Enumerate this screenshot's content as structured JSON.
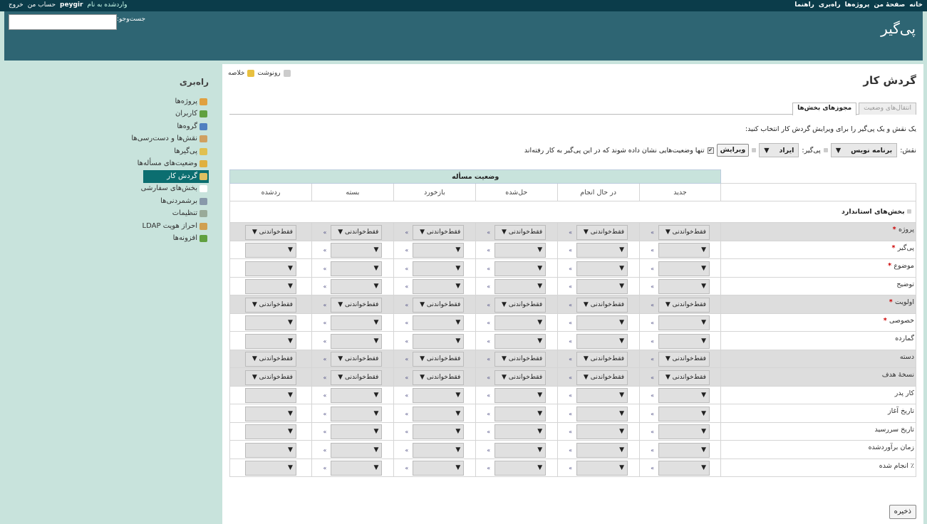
{
  "topbar": {
    "menu": [
      "خانه",
      "صفحهٔ من",
      "پروژه‌ها",
      "راه‌بری",
      "راهنما"
    ],
    "logged_in_label": "واردشده به نام",
    "username": "peygir",
    "my_account": "حساب من",
    "logout": "خروج"
  },
  "header": {
    "title": "پی‌گیر",
    "search_label": "جست‌وجو:"
  },
  "sidebar": {
    "title": "راه‌بری",
    "items": [
      {
        "label": "پروژه‌ها",
        "icon": "projects-icon",
        "color": "#e0a040"
      },
      {
        "label": "کاربران",
        "icon": "users-icon",
        "color": "#60a040"
      },
      {
        "label": "گروه‌ها",
        "icon": "groups-icon",
        "color": "#5080c0"
      },
      {
        "label": "نقش‌ها و دست‌رسی‌ها",
        "icon": "roles-icon",
        "color": "#d0a060"
      },
      {
        "label": "پی‌گیرها",
        "icon": "trackers-icon",
        "color": "#e0c050"
      },
      {
        "label": "وضعیت‌های مسأله‌ها",
        "icon": "issue-statuses-icon",
        "color": "#e0b040"
      },
      {
        "label": "گردش کار",
        "icon": "workflow-icon",
        "color": "#e0c060",
        "selected": true
      },
      {
        "label": "بخش‌های سفارشی",
        "icon": "custom-fields-icon",
        "color": "#ffffff"
      },
      {
        "label": "برشمردنی‌ها",
        "icon": "enumerations-icon",
        "color": "#8899aa"
      },
      {
        "label": "تنظیمات",
        "icon": "settings-icon",
        "color": "#99aa99"
      },
      {
        "label": "احراز هویت LDAP",
        "icon": "ldap-icon",
        "color": "#d0a050"
      },
      {
        "label": "افزونه‌ها",
        "icon": "plugins-icon",
        "color": "#60a040"
      }
    ]
  },
  "page": {
    "title": "گردش کار",
    "context_links": [
      "خلاصه",
      "رونوشت"
    ],
    "tabs": [
      "انتقال‌های وضعیت",
      "مجوزهای بخش‌ها"
    ],
    "active_tab": 1,
    "instruction": "یک نقش و یک پی‌گیر را برای ویرایش گردش کار انتخاب کنید:",
    "role_label": "نقش:",
    "role_value": "برنامه نویس",
    "tracker_label": "پی‌گیر:",
    "tracker_value": "ایراد",
    "edit_button": "ویرایش",
    "only_used_label": "تنها وضعیت‌هایی نشان داده شوند که در این پی‌گیر به کار رفته‌اند",
    "save_button": "ذخیره"
  },
  "table": {
    "status_header": "وضعیت مسأله",
    "statuses": [
      "جدید",
      "در حال انجام",
      "حل‌شده",
      "بازخورد",
      "بسته",
      "ردشده"
    ],
    "group_label": "بخش‌های استاندارد",
    "readonly_label": "فقط‌خواندنی",
    "arrow": "»",
    "fields": [
      {
        "name": "پروژه",
        "required": true,
        "readonly": true
      },
      {
        "name": "پی‌گیر",
        "required": true,
        "readonly": false
      },
      {
        "name": "موضوع",
        "required": true,
        "readonly": false
      },
      {
        "name": "توضیح",
        "required": false,
        "readonly": false
      },
      {
        "name": "اولویت",
        "required": true,
        "readonly": true
      },
      {
        "name": "خصوصی",
        "required": true,
        "readonly": false
      },
      {
        "name": "گمارده",
        "required": false,
        "readonly": false
      },
      {
        "name": "دسته",
        "required": false,
        "readonly": true
      },
      {
        "name": "نسخهٔ هدف",
        "required": false,
        "readonly": true
      },
      {
        "name": "کار پدر",
        "required": false,
        "readonly": false
      },
      {
        "name": "تاریخ آغاز",
        "required": false,
        "readonly": false
      },
      {
        "name": "تاریخ سررسید",
        "required": false,
        "readonly": false
      },
      {
        "name": "زمان برآوردشده",
        "required": false,
        "readonly": false
      },
      {
        "name": "٪ انجام شده",
        "required": false,
        "readonly": false
      }
    ]
  }
}
